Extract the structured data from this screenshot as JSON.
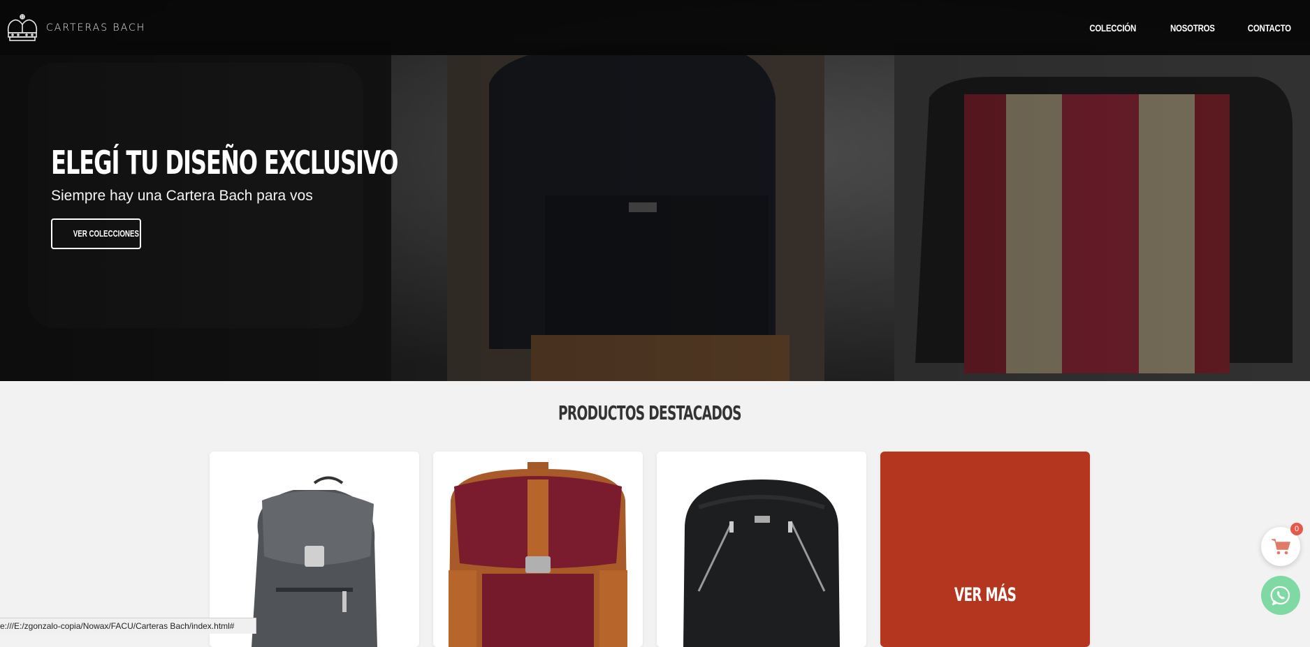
{
  "brand": {
    "name": "CARTERAS BACH",
    "logo_icon": "crown-icon"
  },
  "nav": {
    "items": [
      {
        "label": "COLECCIÓN"
      },
      {
        "label": "NOSOTROS"
      },
      {
        "label": "CONTACTO"
      }
    ]
  },
  "hero": {
    "title": "ELEGÍ TU DISEÑO EXCLUSIVO",
    "subtitle": "Siempre hay una Cartera Bach para vos",
    "button_label": "VER COLECCIONES"
  },
  "featured": {
    "title": "PRODUCTOS DESTACADOS",
    "products": [
      {
        "icon": "backpack-grey-icon"
      },
      {
        "icon": "backpack-burgundy-icon"
      },
      {
        "icon": "backpack-black-icon"
      }
    ],
    "more_label": "VER MÁS"
  },
  "cart": {
    "count": "0",
    "icon": "cart-icon"
  },
  "whatsapp": {
    "icon": "whatsapp-icon"
  },
  "status_url": "e:///E:/zgonzalo-copia/Nowax/FACU/Carteras Bach/index.html#",
  "colors": {
    "accent": "#b5361e",
    "whatsapp": "#7fd9a2",
    "navbar": "#080808"
  }
}
